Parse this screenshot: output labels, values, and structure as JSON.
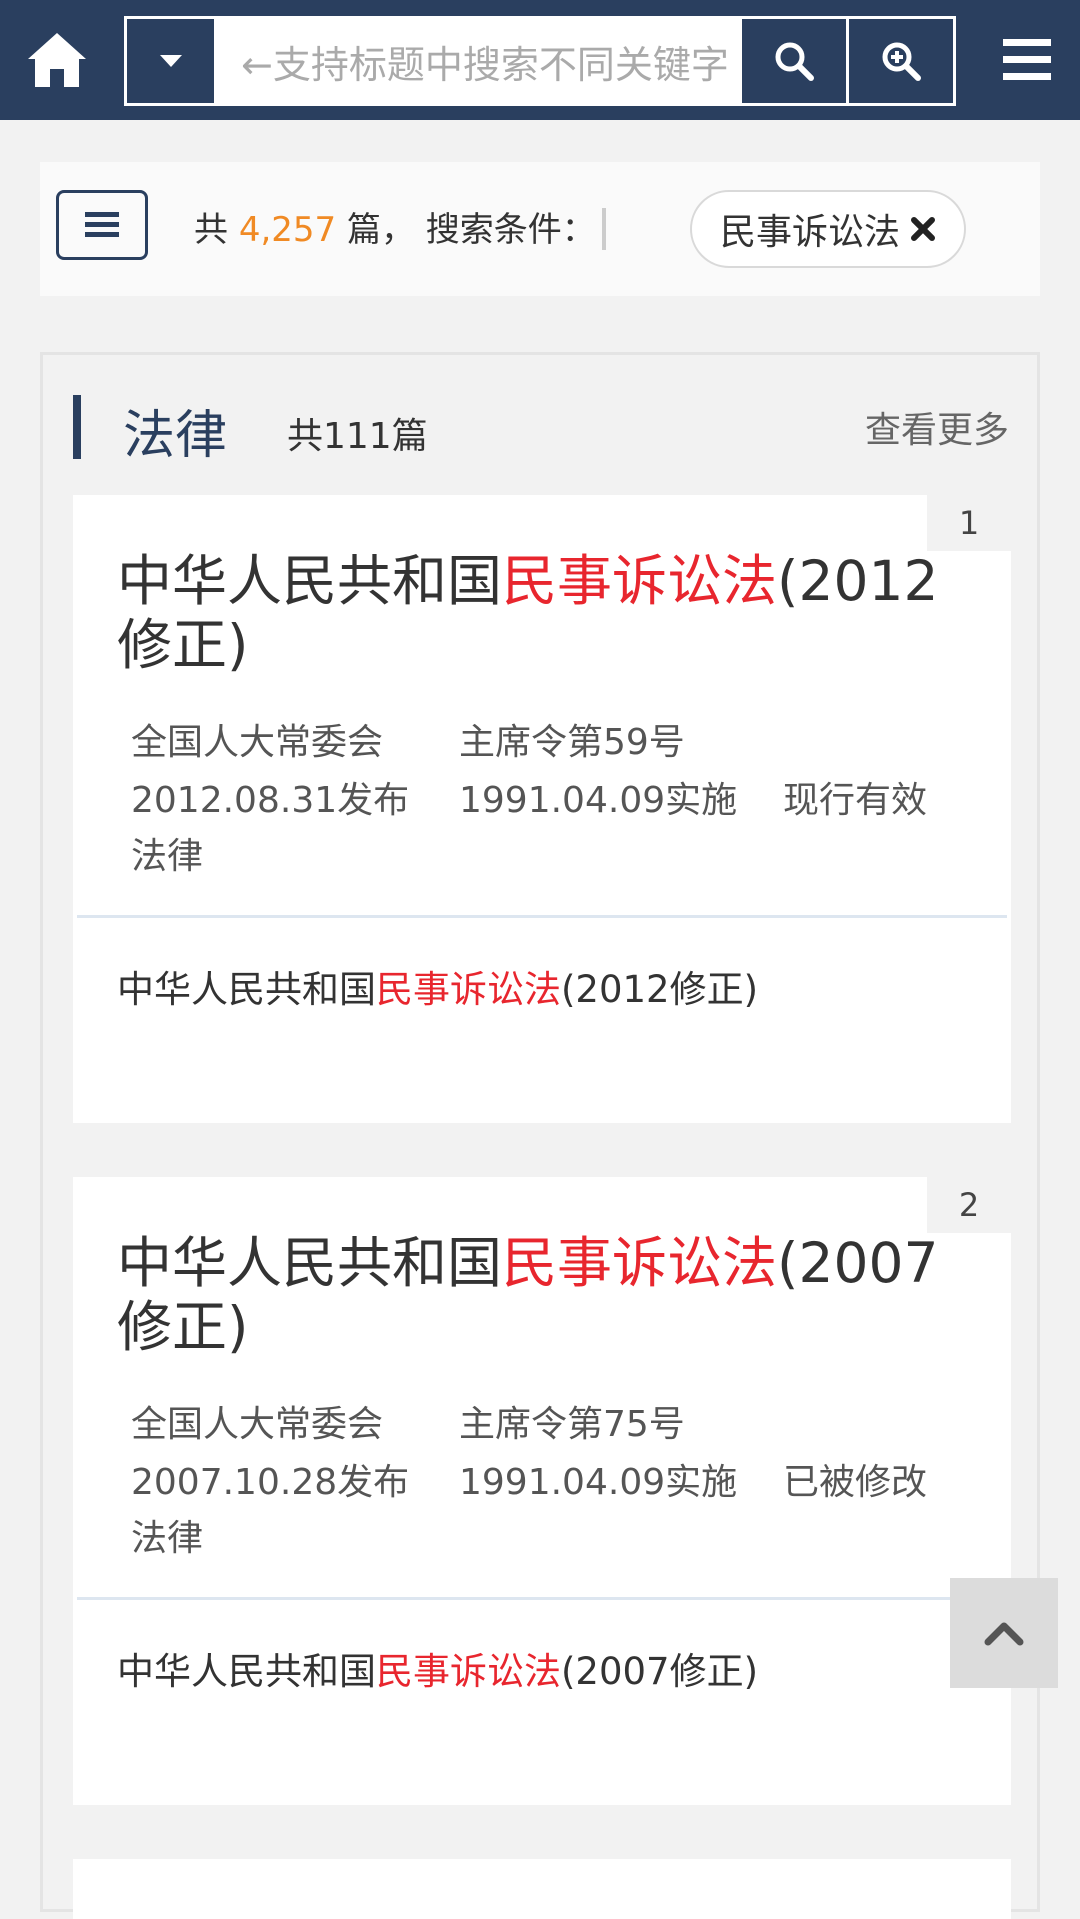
{
  "search": {
    "placeholder": "←支持标题中搜索不同关键字"
  },
  "filter": {
    "prefix": "共 ",
    "count": "4,257",
    "suffix": " 篇， 搜索条件：",
    "tag": "民事诉讼法"
  },
  "section": {
    "title": "法律",
    "count": "共111篇",
    "more": "查看更多"
  },
  "cards": [
    {
      "num": "1",
      "title_pre": "中华人民共和国",
      "title_hl": "民事诉讼法",
      "title_post": "(2012修正)",
      "issuer": "全国人大常委会",
      "order": "主席令第59号",
      "publish": "2012.08.31发布",
      "effective": "1991.04.09实施",
      "status": "现行有效",
      "category": "法律",
      "sub_pre": "中华人民共和国",
      "sub_hl": "民事诉讼法",
      "sub_post": "(2012修正)"
    },
    {
      "num": "2",
      "title_pre": "中华人民共和国",
      "title_hl": "民事诉讼法",
      "title_post": "(2007修正)",
      "issuer": "全国人大常委会",
      "order": "主席令第75号",
      "publish": "2007.10.28发布",
      "effective": "1991.04.09实施",
      "status": "已被修改",
      "category": "法律",
      "sub_pre": "中华人民共和国",
      "sub_hl": "民事诉讼法",
      "sub_post": "(2007修正)"
    }
  ],
  "colors": {
    "navy": "#2a3f5f",
    "highlight": "#e8262e",
    "count": "#f08a24"
  }
}
